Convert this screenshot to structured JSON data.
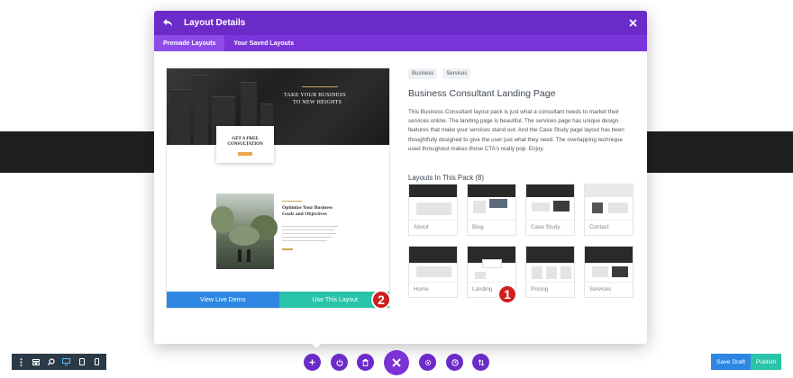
{
  "modal": {
    "title": "Layout Details",
    "tabs": [
      "Premade Layouts",
      "Your Saved Layouts"
    ]
  },
  "preview": {
    "hero_title_line1": "TAKE YOUR BUSINESS",
    "hero_title_line2": "TO NEW HEIGHTS",
    "cta_line1": "GET A FREE",
    "cta_line2": "CONSULTATION",
    "section_title_line1": "Optimize Your Business",
    "section_title_line2": "Goals and Objectives",
    "view_demo_label": "View Live Demo",
    "use_layout_label": "Use This Layout"
  },
  "details": {
    "tags": [
      "Business",
      "Services"
    ],
    "title": "Business Consultant Landing Page",
    "description": "This Business Consultant layout pack is just what a consultant needs to market their services online. The landing page is beautiful. The services page has unique design features that make your services stand out. And the Case Study page layout has been thoughtfully designed to give the user just what they need. The overlapping technique used throughout makes those CTA's really pop. Enjoy.",
    "pack_title": "Layouts In This Pack (8)"
  },
  "layouts": [
    {
      "label": "About"
    },
    {
      "label": "Blog"
    },
    {
      "label": "Case Study"
    },
    {
      "label": "Contact"
    },
    {
      "label": "Home"
    },
    {
      "label": "Landing"
    },
    {
      "label": "Pricing"
    },
    {
      "label": "Services"
    }
  ],
  "annotations": {
    "badge1": "1",
    "badge2": "2"
  },
  "toolbar": {
    "save_draft": "Save Draft",
    "publish": "Publish"
  },
  "colors": {
    "header_purple": "#6b2bc9",
    "tab_purple": "#7a34d9",
    "demo_blue": "#2d87e2",
    "use_teal": "#29c4a9",
    "badge_red": "#d01f1f"
  },
  "icons": {
    "back": "undo-arrow-icon",
    "close": "close-icon",
    "bottom_left": [
      "menu-dots-icon",
      "wireframe-icon",
      "zoom-icon",
      "desktop-icon",
      "tablet-icon",
      "phone-icon"
    ],
    "bottom_center": [
      "add-icon",
      "power-icon",
      "trash-icon",
      "close-icon",
      "settings-icon",
      "history-icon",
      "sort-icon"
    ]
  }
}
